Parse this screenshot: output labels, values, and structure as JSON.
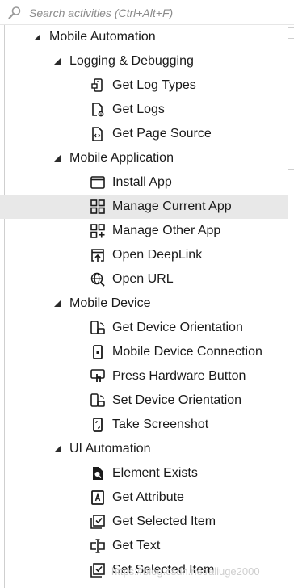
{
  "search": {
    "placeholder": "Search activities (Ctrl+Alt+F)"
  },
  "tree": {
    "mobile_automation": "Mobile Automation",
    "logging": {
      "label": "Logging & Debugging",
      "items": [
        "Get Log Types",
        "Get Logs",
        "Get Page Source"
      ]
    },
    "mobile_application": {
      "label": "Mobile Application",
      "items": [
        "Install App",
        "Manage Current App",
        "Manage Other App",
        "Open DeepLink",
        "Open URL"
      ]
    },
    "mobile_device": {
      "label": "Mobile Device",
      "items": [
        "Get Device Orientation",
        "Mobile Device Connection",
        "Press Hardware Button",
        "Set Device Orientation",
        "Take Screenshot"
      ]
    },
    "ui_automation": {
      "label": "UI Automation",
      "items": [
        "Element Exists",
        "Get Attribute",
        "Get Selected Item",
        "Get Text",
        "Set Selected Item"
      ]
    }
  },
  "watermark": "https://blog.csdn.net/aliuge2000",
  "colors": {
    "selected_row": "#e8e8e8",
    "text": "#1a1a1a",
    "placeholder": "#8a8a8a"
  }
}
